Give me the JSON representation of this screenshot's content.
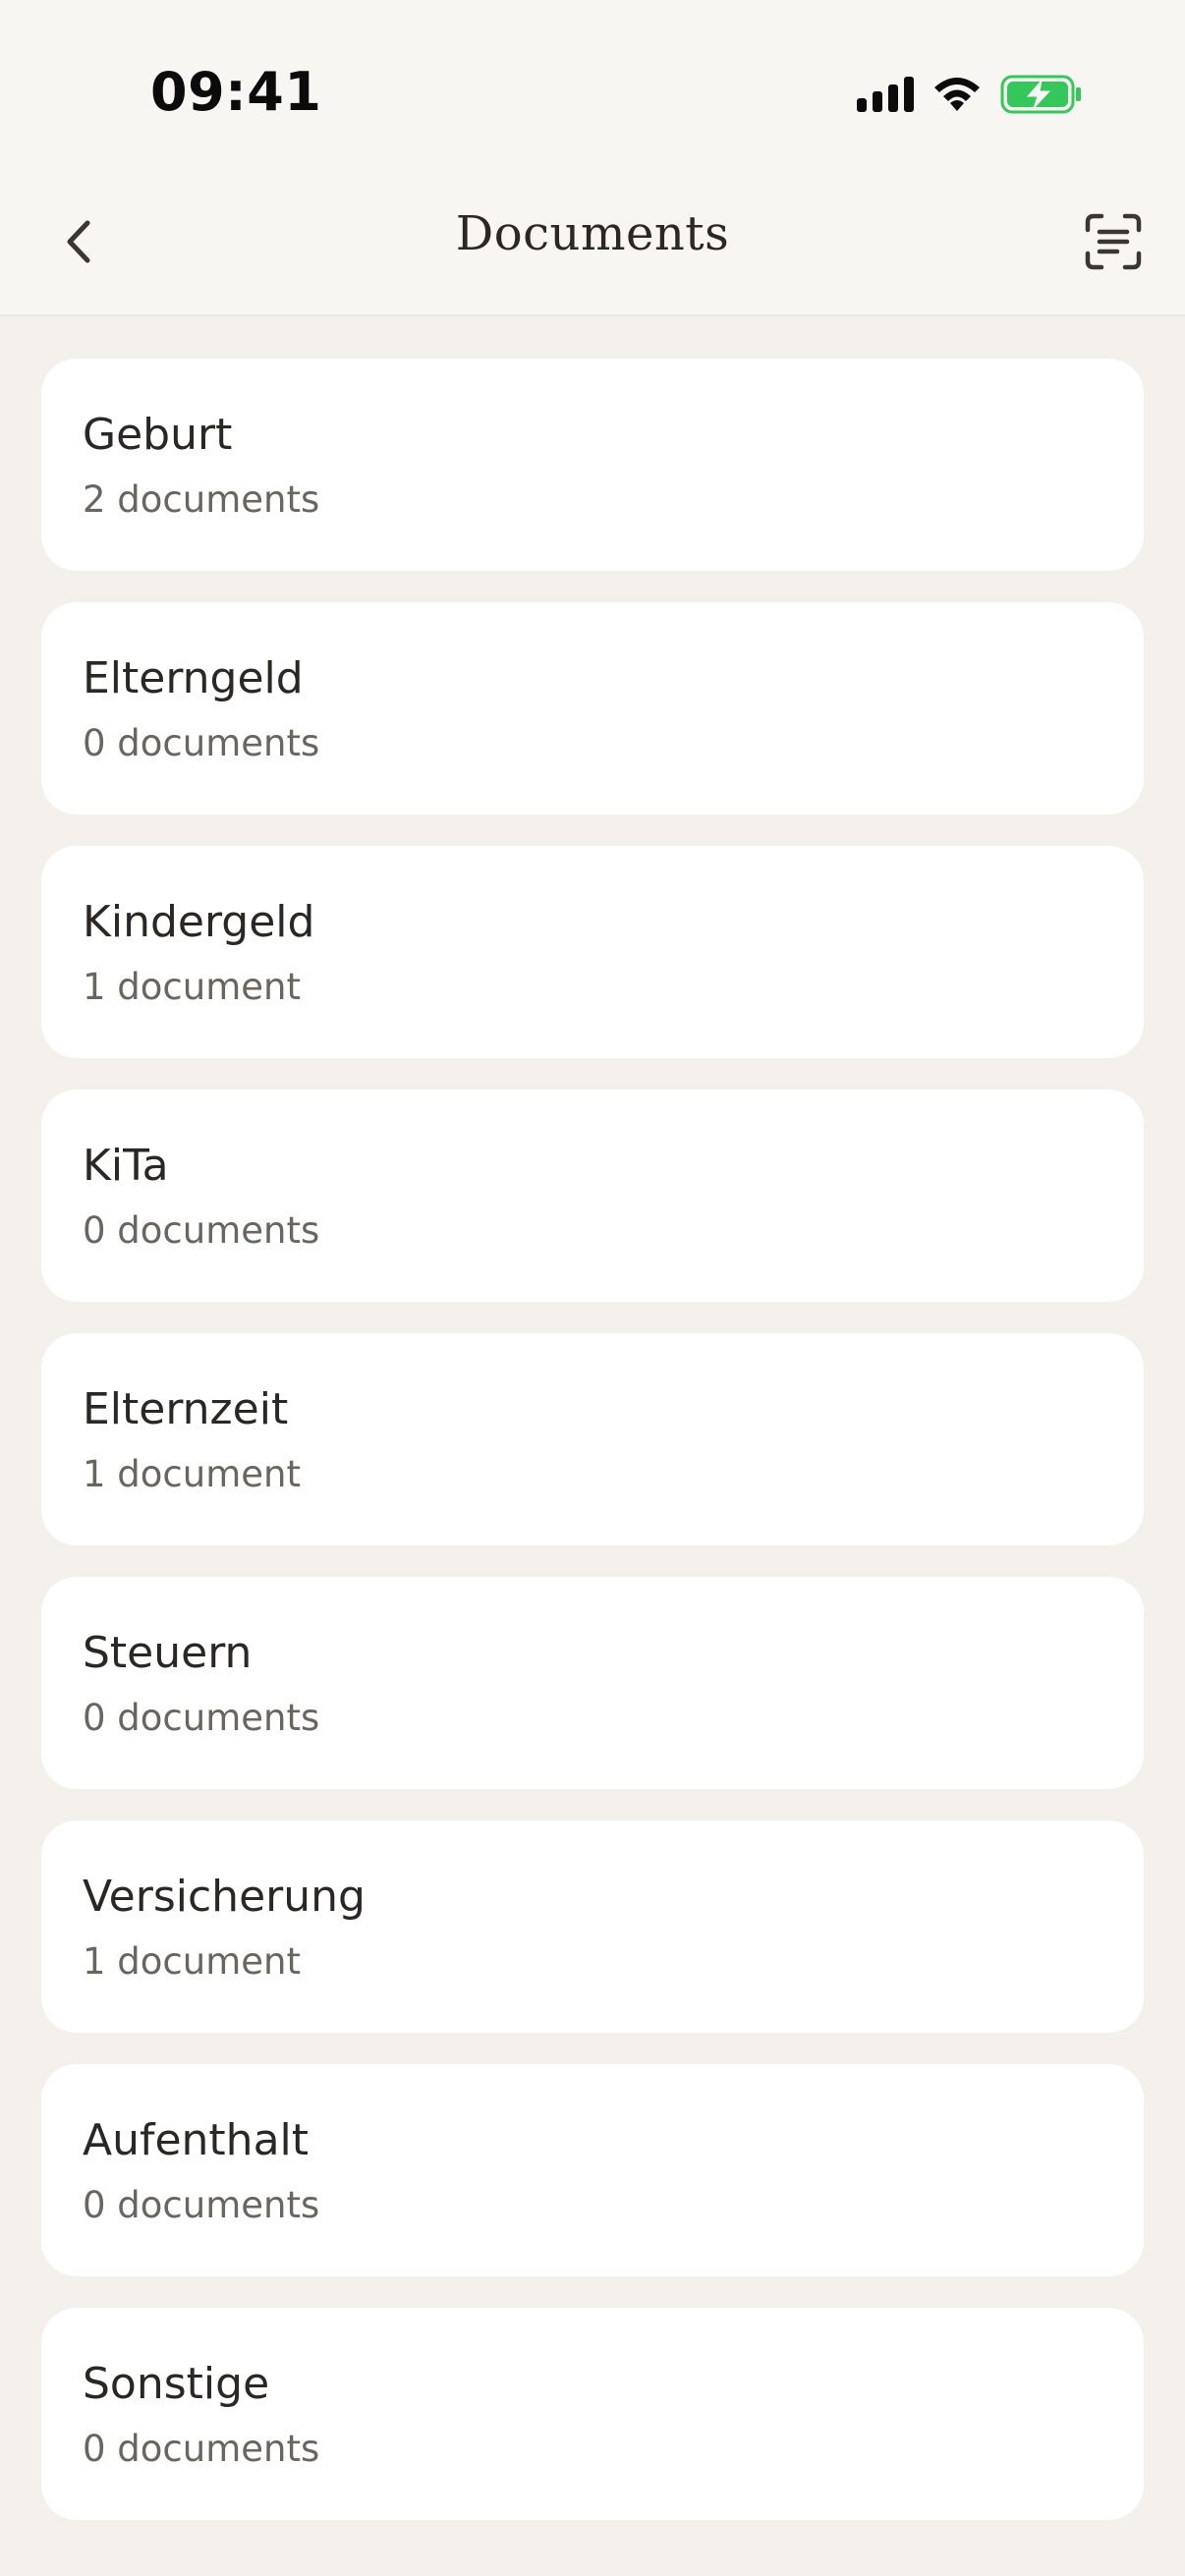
{
  "status_bar": {
    "time": "09:41",
    "icons": [
      "cellular-signal-icon",
      "wifi-icon",
      "battery-charging-icon"
    ],
    "battery_color": "#34c759"
  },
  "nav": {
    "title": "Documents",
    "back_icon": "chevron-left-icon",
    "scan_icon": "document-scan-icon"
  },
  "categories": [
    {
      "name": "Geburt",
      "count": "2 documents"
    },
    {
      "name": "Elterngeld",
      "count": "0 documents"
    },
    {
      "name": "Kindergeld",
      "count": "1 document"
    },
    {
      "name": "KiTa",
      "count": "0 documents"
    },
    {
      "name": "Elternzeit",
      "count": "1 document"
    },
    {
      "name": "Steuern",
      "count": "0 documents"
    },
    {
      "name": "Versicherung",
      "count": "1 document"
    },
    {
      "name": "Aufenthalt",
      "count": "0 documents"
    },
    {
      "name": "Sonstige",
      "count": "0 documents"
    }
  ],
  "colors": {
    "background": "#f4f1ec",
    "card": "#ffffff",
    "text_primary": "#2a2724",
    "text_secondary": "#6a655f"
  }
}
